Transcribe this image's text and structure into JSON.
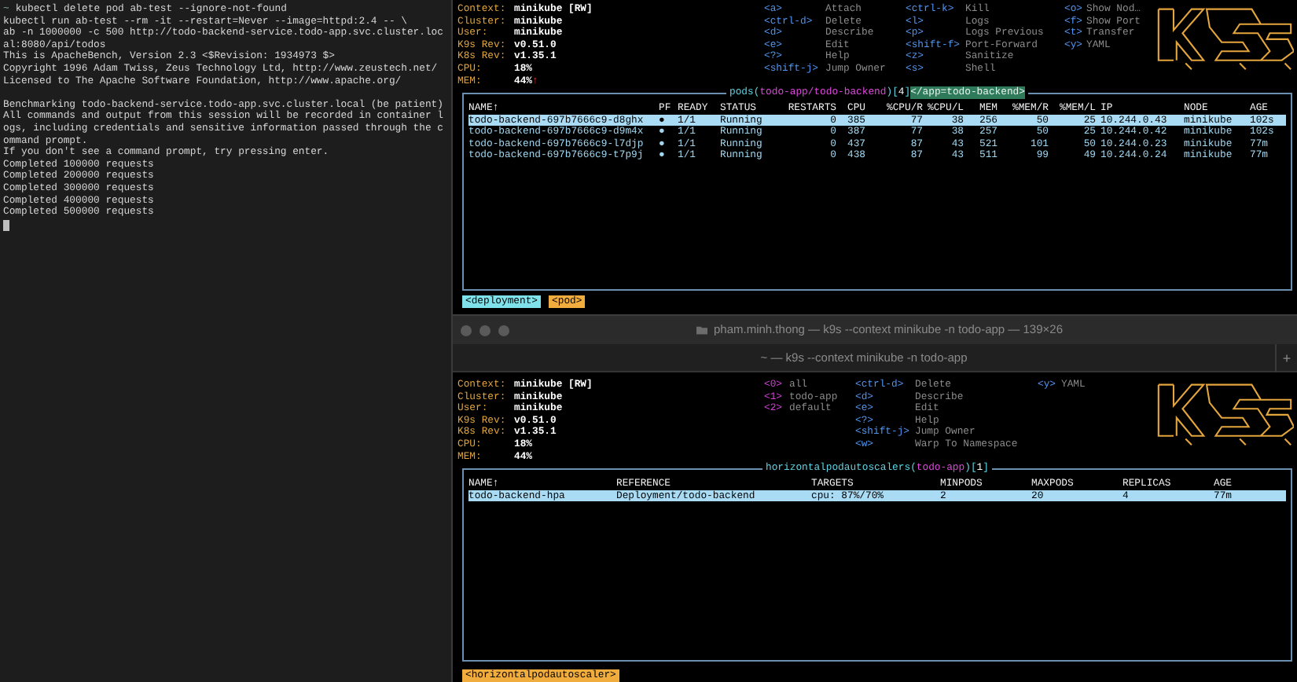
{
  "left_terminal": {
    "lines": [
      {
        "prompt": "~",
        "text": "kubectl delete pod ab-test --ignore-not-found"
      },
      {
        "text": "kubectl run ab-test --rm -it --restart=Never --image=httpd:2.4 -- \\"
      },
      {
        "text": "ab -n 1000000 -c 500 http://todo-backend-service.todo-app.svc.cluster.loc"
      },
      {
        "text": "al:8080/api/todos"
      },
      {
        "text": "This is ApacheBench, Version 2.3 <$Revision: 1934973 $>"
      },
      {
        "text": "Copyright 1996 Adam Twiss, Zeus Technology Ltd, http://www.zeustech.net/"
      },
      {
        "text": "Licensed to The Apache Software Foundation, http://www.apache.org/"
      },
      {
        "text": "Benchmarking todo-backend-service.todo-app.svc.cluster.local (be patient)",
        "spaced_before": true
      },
      {
        "text": "All commands and output from this session will be recorded in container l"
      },
      {
        "text": "ogs, including credentials and sensitive information passed through the c"
      },
      {
        "text": "ommand prompt."
      },
      {
        "text": "If you don't see a command prompt, try pressing enter."
      },
      {
        "text": "Completed 100000 requests"
      },
      {
        "text": "Completed 200000 requests"
      },
      {
        "text": "Completed 300000 requests"
      },
      {
        "text": "Completed 400000 requests"
      },
      {
        "text": "Completed 500000 requests"
      }
    ],
    "cursor": true
  },
  "top_pane": {
    "header": {
      "info": [
        {
          "label": "Context:",
          "value": "minikube [RW]"
        },
        {
          "label": "Cluster:",
          "value": "minikube"
        },
        {
          "label": "User:",
          "value": "minikube"
        },
        {
          "label": "K9s Rev:",
          "value": "v0.51.0"
        },
        {
          "label": "K8s Rev:",
          "value": "v1.35.1"
        },
        {
          "label": "CPU:",
          "value": "18%"
        },
        {
          "label": "MEM:",
          "value": "44%",
          "trend": "↑"
        }
      ],
      "hint_columns": [
        [
          {
            "key": "<a>",
            "action": "Attach",
            "kind": "command"
          },
          {
            "key": "<ctrl-d>",
            "action": "Delete",
            "kind": "command"
          },
          {
            "key": "<d>",
            "action": "Describe",
            "kind": "command"
          },
          {
            "key": "<e>",
            "action": "Edit",
            "kind": "command"
          },
          {
            "key": "<?>",
            "action": "Help",
            "kind": "command"
          },
          {
            "key": "<shift-j>",
            "action": "Jump Owner",
            "kind": "command"
          }
        ],
        [
          {
            "key": "<ctrl-k>",
            "action": "Kill",
            "kind": "command"
          },
          {
            "key": "<l>",
            "action": "Logs",
            "kind": "command"
          },
          {
            "key": "<p>",
            "action": "Logs Previous",
            "kind": "command"
          },
          {
            "key": "<shift-f>",
            "action": "Port-Forward",
            "kind": "command"
          },
          {
            "key": "<z>",
            "action": "Sanitize",
            "kind": "command"
          },
          {
            "key": "<s>",
            "action": "Shell",
            "kind": "command"
          }
        ],
        [
          {
            "key": "<o>",
            "action": "Show Nod…",
            "kind": "command"
          },
          {
            "key": "<f>",
            "action": "Show Port",
            "kind": "command"
          },
          {
            "key": "<t>",
            "action": "Transfer",
            "kind": "command"
          },
          {
            "key": "<y>",
            "action": "YAML",
            "kind": "command"
          }
        ]
      ]
    },
    "table": {
      "title": [
        {
          "text": "pods",
          "kind": "resource"
        },
        {
          "text": "(",
          "kind": "punct"
        },
        {
          "text": "todo-app/todo-backend",
          "kind": "namespace"
        },
        {
          "text": ")",
          "kind": "punct"
        },
        {
          "text": "[",
          "kind": "punct"
        },
        {
          "text": "4",
          "kind": "count"
        },
        {
          "text": "]",
          "kind": "punct"
        },
        {
          "text": "</app=todo-backend>",
          "kind": "filter"
        }
      ],
      "columns": [
        "NAME↑",
        "PF",
        "READY",
        "STATUS",
        "RESTARTS",
        "CPU",
        "%CPU/R",
        "%CPU/L",
        "MEM",
        "%MEM/R",
        "%MEM/L",
        "IP",
        "NODE",
        "AGE"
      ],
      "rows": [
        {
          "selected": true,
          "cells": [
            "todo-backend-697b7666c9-d8ghx",
            "●",
            "1/1",
            "Running",
            "0",
            "385",
            "77",
            "38",
            "256",
            "50",
            "25",
            "10.244.0.43",
            "minikube",
            "102s"
          ]
        },
        {
          "selected": false,
          "cells": [
            "todo-backend-697b7666c9-d9m4x",
            "●",
            "1/1",
            "Running",
            "0",
            "387",
            "77",
            "38",
            "257",
            "50",
            "25",
            "10.244.0.42",
            "minikube",
            "102s"
          ]
        },
        {
          "selected": false,
          "cells": [
            "todo-backend-697b7666c9-l7djp",
            "●",
            "1/1",
            "Running",
            "0",
            "437",
            "87",
            "43",
            "521",
            "101",
            "50",
            "10.244.0.23",
            "minikube",
            "77m"
          ]
        },
        {
          "selected": false,
          "cells": [
            "todo-backend-697b7666c9-t7p9j",
            "●",
            "1/1",
            "Running",
            "0",
            "438",
            "87",
            "43",
            "511",
            "99",
            "49",
            "10.244.0.24",
            "minikube",
            "77m"
          ]
        }
      ]
    },
    "crumbs": [
      {
        "label": "<deployment>",
        "selected": false
      },
      {
        "label": "<pod>",
        "selected": true
      }
    ]
  },
  "bottom_window": {
    "title": "pham.minh.thong — k9s --context minikube -n todo-app — 139×26",
    "tab": "~ — k9s --context minikube -n todo-app",
    "new_tab": "+",
    "pane": {
      "header": {
        "info": [
          {
            "label": "Context:",
            "value": "minikube [RW]"
          },
          {
            "label": "Cluster:",
            "value": "minikube"
          },
          {
            "label": "User:",
            "value": "minikube"
          },
          {
            "label": "K9s Rev:",
            "value": "v0.51.0"
          },
          {
            "label": "K8s Rev:",
            "value": "v1.35.1"
          },
          {
            "label": "CPU:",
            "value": "18%"
          },
          {
            "label": "MEM:",
            "value": "44%"
          }
        ],
        "hint_columns": [
          [
            {
              "key": "<0>",
              "action": "all",
              "kind": "namespace"
            },
            {
              "key": "<1>",
              "action": "todo-app",
              "kind": "namespace"
            },
            {
              "key": "<2>",
              "action": "default",
              "kind": "namespace"
            }
          ],
          [
            {
              "key": "<ctrl-d>",
              "action": "Delete",
              "kind": "command"
            },
            {
              "key": "<d>",
              "action": "Describe",
              "kind": "command"
            },
            {
              "key": "<e>",
              "action": "Edit",
              "kind": "command"
            },
            {
              "key": "<?>",
              "action": "Help",
              "kind": "command"
            },
            {
              "key": "<shift-j>",
              "action": "Jump Owner",
              "kind": "command"
            },
            {
              "key": "<w>",
              "action": "Warp To Namespace",
              "kind": "command"
            }
          ],
          [
            {
              "key": "<y>",
              "action": "YAML",
              "kind": "command"
            }
          ]
        ]
      },
      "table": {
        "title": [
          {
            "text": "horizontalpodautoscalers",
            "kind": "resource"
          },
          {
            "text": "(",
            "kind": "punct"
          },
          {
            "text": "todo-app",
            "kind": "namespace"
          },
          {
            "text": ")",
            "kind": "punct"
          },
          {
            "text": "[",
            "kind": "punct"
          },
          {
            "text": "1",
            "kind": "count"
          },
          {
            "text": "]",
            "kind": "punct"
          }
        ],
        "columns": [
          "NAME↑",
          "REFERENCE",
          "TARGETS",
          "MINPODS",
          "MAXPODS",
          "REPLICAS",
          "AGE"
        ],
        "rows": [
          {
            "selected": true,
            "cells": [
              "todo-backend-hpa",
              "Deployment/todo-backend",
              "cpu: 87%/70%",
              "2",
              "20",
              "4",
              "77m"
            ]
          }
        ]
      },
      "crumbs": [
        {
          "label": "<horizontalpodautoscaler>",
          "selected": true
        }
      ]
    }
  }
}
